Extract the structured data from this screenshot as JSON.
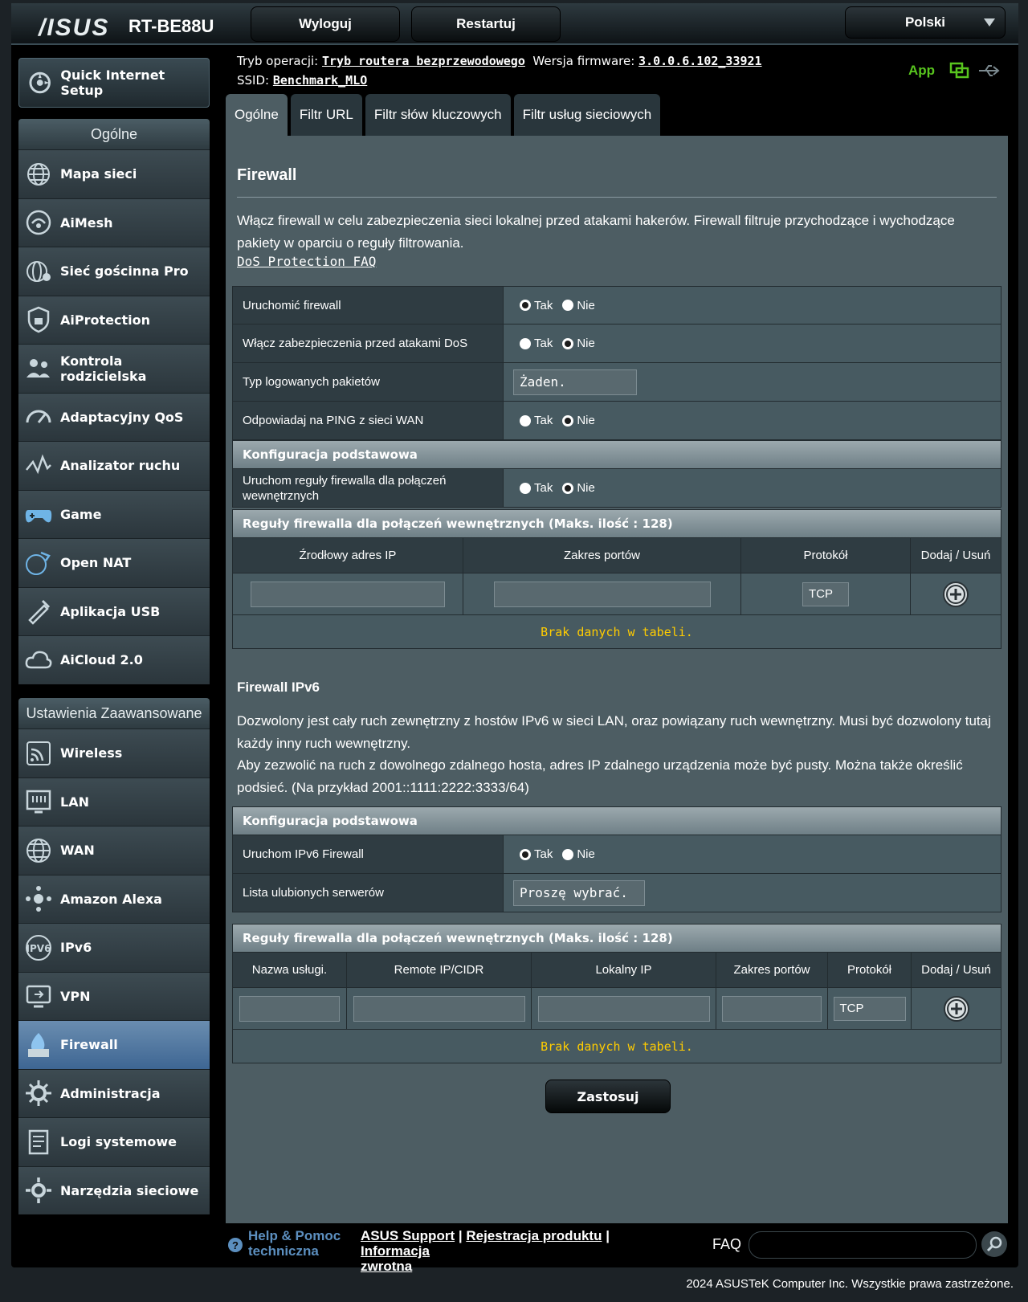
{
  "header": {
    "logo": "/ISUS",
    "model": "RT-BE88U",
    "logout_label": "Wyloguj",
    "restart_label": "Restartuj",
    "language": "Polski"
  },
  "sidebar": {
    "qis_label": "Quick Internet Setup",
    "general_title": "Ogólne",
    "general_items": [
      {
        "label": "Mapa sieci",
        "icon": "globe-network-icon"
      },
      {
        "label": "AiMesh",
        "icon": "aimesh-icon"
      },
      {
        "label": "Sieć gościnna Pro",
        "icon": "guest-network-icon"
      },
      {
        "label": "AiProtection",
        "icon": "shield-lock-icon"
      },
      {
        "label": "Kontrola rodzicielska",
        "icon": "parental-control-icon"
      },
      {
        "label": "Adaptacyjny QoS",
        "icon": "speedometer-icon"
      },
      {
        "label": "Analizator ruchu",
        "icon": "traffic-analyzer-icon"
      },
      {
        "label": "Game",
        "icon": "gamepad-icon"
      },
      {
        "label": "Open NAT",
        "icon": "open-nat-icon"
      },
      {
        "label": "Aplikacja USB",
        "icon": "usb-app-icon"
      },
      {
        "label": "AiCloud 2.0",
        "icon": "cloud-icon"
      }
    ],
    "advanced_title": "Ustawienia Zaawansowane",
    "advanced_items": [
      {
        "label": "Wireless",
        "icon": "wireless-icon"
      },
      {
        "label": "LAN",
        "icon": "lan-icon"
      },
      {
        "label": "WAN",
        "icon": "wan-globe-icon"
      },
      {
        "label": "Amazon Alexa",
        "icon": "alexa-icon"
      },
      {
        "label": "IPv6",
        "icon": "ipv6-icon"
      },
      {
        "label": "VPN",
        "icon": "vpn-icon"
      },
      {
        "label": "Firewall",
        "icon": "firewall-icon",
        "active": true
      },
      {
        "label": "Administracja",
        "icon": "admin-gear-icon"
      },
      {
        "label": "Logi systemowe",
        "icon": "system-log-icon"
      },
      {
        "label": "Narzędzia sieciowe",
        "icon": "network-tools-icon"
      }
    ]
  },
  "info": {
    "mode_label": "Tryb operacji:",
    "mode_value": "Tryb routera bezprzewodowego",
    "fw_label": "Wersja firmware:",
    "fw_value": "3.0.0.6.102_33921",
    "ssid_label": "SSID:",
    "ssid_value": "Benchmark_MLO",
    "app_label": "App"
  },
  "tabs": [
    "Ogólne",
    "Filtr URL",
    "Filtr słów kluczowych",
    "Filtr usług sieciowych"
  ],
  "firewall": {
    "title": "Firewall",
    "description": "Włącz firewall w celu zabezpieczenia sieci lokalnej przed atakami hakerów. Firewall filtruje przychodzące i wychodzące pakiety w oparciu o reguły filtrowania.",
    "faq_link": "DoS Protection FAQ",
    "yes": "Tak",
    "no": "Nie",
    "rows": [
      {
        "label": "Uruchomić firewall",
        "value": "Tak"
      },
      {
        "label": "Włącz zabezpieczenia przed atakami DoS",
        "value": "Nie"
      },
      {
        "label": "Typ logowanych pakietów",
        "select": "Żaden."
      },
      {
        "label": "Odpowiadaj na PING z sieci WAN",
        "value": "Nie"
      }
    ],
    "basic_config_title": "Konfiguracja podstawowa",
    "internal_rules_label": "Uruchom reguły firewalla dla połączeń wewnętrznych",
    "internal_rules_value": "Nie",
    "rules_title": "Reguły firewalla dla połączeń wewnętrznych (Maks. ilość : 128)",
    "rules_columns": [
      "Źrodłowy adres IP",
      "Zakres portów",
      "Protokół",
      "Dodaj / Usuń"
    ],
    "protocol_value": "TCP",
    "empty_text": "Brak danych w tabeli."
  },
  "ipv6": {
    "title": "Firewall IPv6",
    "desc1": "Dozwolony jest cały ruch zewnętrzny z hostów IPv6 w sieci LAN, oraz powiązany ruch wewnętrzny. Musi być dozwolony tutaj każdy inny ruch wewnętrzny.",
    "desc2": "Aby zezwolić na ruch z dowolnego zdalnego hosta, adres IP zdalnego urządzenia może być pusty. Można także określić podsieć. (Na przykład 2001::1111:2222:3333/64)",
    "basic_config_title": "Konfiguracja podstawowa",
    "enable_label": "Uruchom IPv6 Firewall",
    "enable_value": "Tak",
    "fav_label": "Lista ulubionych serwerów",
    "fav_select": "Proszę wybrać.",
    "rules_title": "Reguły firewalla dla połączeń wewnętrznych (Maks. ilość : 128)",
    "rules_columns": [
      "Nazwa usługi.",
      "Remote IP/CIDR",
      "Lokalny IP",
      "Zakres portów",
      "Protokół",
      "Dodaj / Usuń"
    ],
    "protocol_value": "TCP",
    "empty_text": "Brak danych w tabeli."
  },
  "apply_label": "Zastosuj",
  "footer": {
    "help_line1": "Help & Pomoc",
    "help_line2": "techniczna",
    "support": "ASUS Support",
    "register": "Rejestracja produktu",
    "feedback_1": "Informacja",
    "feedback_2": "zwrotna",
    "sep": "|",
    "faq": "FAQ",
    "copyright": "2024 ASUSTeK Computer Inc. Wszystkie prawa zastrzeżone."
  },
  "colors": {
    "accent_green": "#58c51e",
    "empty_text": "#ffcc00",
    "help_blue": "#5c8fbf",
    "active_item": "#4f78a3"
  }
}
